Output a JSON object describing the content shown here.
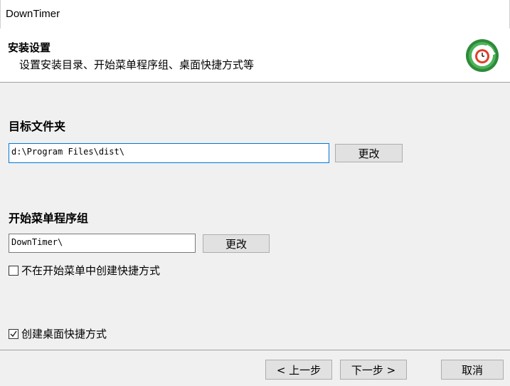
{
  "window": {
    "title": "DownTimer"
  },
  "header": {
    "title": "安装设置",
    "subtitle": "设置安装目录、开始菜单程序组、桌面快捷方式等",
    "logo_icon": "installer-logo-icon"
  },
  "destination": {
    "label": "目标文件夹",
    "path_value": "d:\\Program Files\\dist\\",
    "change_label": "更改"
  },
  "start_menu": {
    "label": "开始菜单程序组",
    "group_value": "DownTimer\\",
    "change_label": "更改",
    "no_shortcut_label": "不在开始菜单中创建快捷方式",
    "no_shortcut_checked": false
  },
  "desktop": {
    "shortcut_label": "创建桌面快捷方式",
    "shortcut_checked": true
  },
  "footer": {
    "back_label": "< 上一步",
    "next_label": "下一步 >",
    "cancel_label": "取消"
  },
  "colors": {
    "accent_focus": "#0078d7",
    "logo_green": "#3ea34a",
    "logo_red": "#e0402a"
  }
}
